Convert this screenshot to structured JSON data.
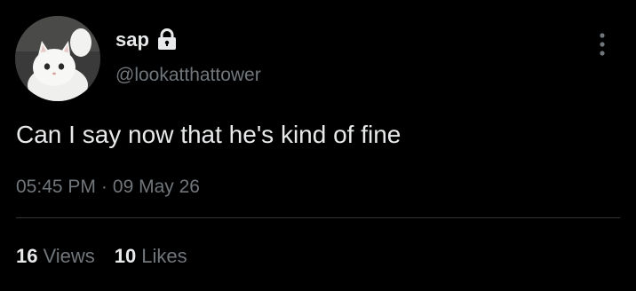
{
  "author": {
    "display_name": "sap",
    "handle": "@lookatthattower",
    "avatar_icon": "white-kitten-avatar",
    "protected_icon": "lock-icon"
  },
  "tweet": {
    "text": "Can I say now that he's kind of fine",
    "time": "05:45 PM",
    "separator": "·",
    "date": "09 May 26"
  },
  "stats": {
    "views_count": "16",
    "views_label": "Views",
    "likes_count": "10",
    "likes_label": "Likes"
  },
  "menu": {
    "more_icon": "more-vertical-icon"
  },
  "colors": {
    "background": "#000000",
    "primary_text": "#e7e9ea",
    "secondary_text": "#71767b",
    "divider": "#2f3336"
  }
}
